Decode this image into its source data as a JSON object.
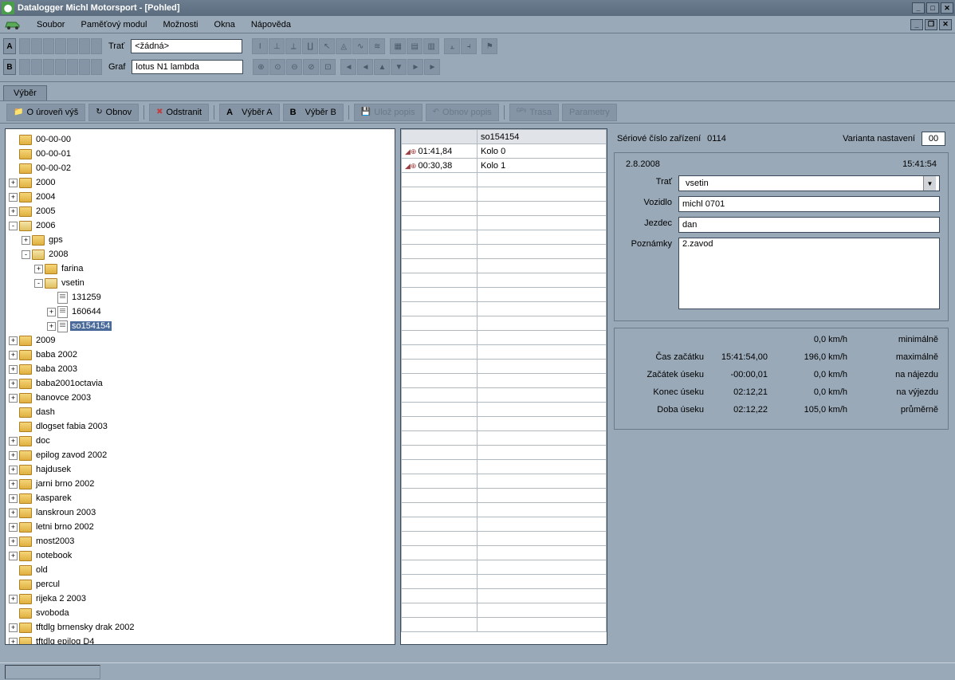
{
  "window": {
    "title": "Datalogger Michl Motorsport - [Pohled]"
  },
  "menu": {
    "items": [
      "Soubor",
      "Paměťový modul",
      "Možnosti",
      "Okna",
      "Nápověda"
    ]
  },
  "toolbar": {
    "trat_label": "Trať",
    "trat_value": "<žádná>",
    "graf_label": "Graf",
    "graf_value": "lotus N1 lambda",
    "a": "A",
    "b": "B"
  },
  "tabs": {
    "vyber": "Výběr"
  },
  "actions": {
    "up": "O úroveň výš",
    "refresh": "Obnov",
    "delete": "Odstranit",
    "sel_a": "Výběr A",
    "sel_b": "Výběr B",
    "save_desc": "Ulož popis",
    "restore_desc": "Obnov popis",
    "trasa": "Trasa",
    "params": "Parametry",
    "a": "A",
    "b": "B"
  },
  "tree": [
    {
      "d": 0,
      "exp": "",
      "ico": "fc",
      "label": "00-00-00"
    },
    {
      "d": 0,
      "exp": "",
      "ico": "fc",
      "label": "00-00-01"
    },
    {
      "d": 0,
      "exp": "",
      "ico": "fc",
      "label": "00-00-02"
    },
    {
      "d": 0,
      "exp": "+",
      "ico": "fc",
      "label": "2000"
    },
    {
      "d": 0,
      "exp": "+",
      "ico": "fc",
      "label": "2004"
    },
    {
      "d": 0,
      "exp": "+",
      "ico": "fc",
      "label": "2005"
    },
    {
      "d": 0,
      "exp": "-",
      "ico": "fo",
      "label": "2006"
    },
    {
      "d": 1,
      "exp": "+",
      "ico": "fc",
      "label": "gps"
    },
    {
      "d": 1,
      "exp": "-",
      "ico": "fo",
      "label": "2008"
    },
    {
      "d": 2,
      "exp": "+",
      "ico": "fc",
      "label": "farina"
    },
    {
      "d": 2,
      "exp": "-",
      "ico": "fo",
      "label": "vsetin"
    },
    {
      "d": 3,
      "exp": "",
      "ico": "file",
      "label": "131259"
    },
    {
      "d": 3,
      "exp": "+",
      "ico": "file",
      "label": "160644"
    },
    {
      "d": 3,
      "exp": "+",
      "ico": "file",
      "label": "so154154",
      "sel": true
    },
    {
      "d": 0,
      "exp": "+",
      "ico": "fc",
      "label": "2009"
    },
    {
      "d": 0,
      "exp": "+",
      "ico": "fc",
      "label": "baba 2002"
    },
    {
      "d": 0,
      "exp": "+",
      "ico": "fc",
      "label": "baba 2003"
    },
    {
      "d": 0,
      "exp": "+",
      "ico": "fc",
      "label": "baba2001octavia"
    },
    {
      "d": 0,
      "exp": "+",
      "ico": "fc",
      "label": "banovce 2003"
    },
    {
      "d": 0,
      "exp": "",
      "ico": "fc",
      "label": "dash"
    },
    {
      "d": 0,
      "exp": "",
      "ico": "fc",
      "label": "dlogset fabia 2003"
    },
    {
      "d": 0,
      "exp": "+",
      "ico": "fc",
      "label": "doc"
    },
    {
      "d": 0,
      "exp": "+",
      "ico": "fc",
      "label": "epilog zavod 2002"
    },
    {
      "d": 0,
      "exp": "+",
      "ico": "fc",
      "label": "hajdusek"
    },
    {
      "d": 0,
      "exp": "+",
      "ico": "fc",
      "label": "jarni brno 2002"
    },
    {
      "d": 0,
      "exp": "+",
      "ico": "fc",
      "label": "kasparek"
    },
    {
      "d": 0,
      "exp": "+",
      "ico": "fc",
      "label": "lanskroun 2003"
    },
    {
      "d": 0,
      "exp": "+",
      "ico": "fc",
      "label": "letni brno 2002"
    },
    {
      "d": 0,
      "exp": "+",
      "ico": "fc",
      "label": "most2003"
    },
    {
      "d": 0,
      "exp": "+",
      "ico": "fc",
      "label": "notebook"
    },
    {
      "d": 0,
      "exp": "",
      "ico": "fc",
      "label": "old"
    },
    {
      "d": 0,
      "exp": "",
      "ico": "fc",
      "label": "percul"
    },
    {
      "d": 0,
      "exp": "+",
      "ico": "fc",
      "label": "rijeka 2 2003"
    },
    {
      "d": 0,
      "exp": "",
      "ico": "fc",
      "label": "svoboda"
    },
    {
      "d": 0,
      "exp": "+",
      "ico": "fc",
      "label": "tftdlg brnensky drak 2002"
    },
    {
      "d": 0,
      "exp": "+",
      "ico": "fc",
      "label": "tftdlg epilog D4"
    }
  ],
  "laps": {
    "header_file": "so154154",
    "rows": [
      {
        "time": "01:41,84",
        "name": "Kolo 0"
      },
      {
        "time": "00:30,38",
        "name": "Kolo 1"
      }
    ],
    "empty_rows": 32
  },
  "detail": {
    "serial_label": "Sériové číslo zařízení",
    "serial_value": "0114",
    "variant_label": "Varianta nastavení",
    "variant_value": "00",
    "date": "2.8.2008",
    "time": "15:41:54",
    "trat_label": "Trať",
    "trat_value": "vsetin",
    "vozidlo_label": "Vozidlo",
    "vozidlo_value": "michl 0701",
    "jezdec_label": "Jezdec",
    "jezdec_value": "dan",
    "poznamky_label": "Poznámky",
    "poznamky_value": "2.zavod"
  },
  "stats": {
    "rows": [
      {
        "l": "",
        "v": "",
        "s": "0,0 km/h",
        "t": "minimálně"
      },
      {
        "l": "Čas začátku",
        "v": "15:41:54,00",
        "s": "196,0 km/h",
        "t": "maximálně"
      },
      {
        "l": "Začátek úseku",
        "v": "-00:00,01",
        "s": "0,0 km/h",
        "t": "na nájezdu"
      },
      {
        "l": "Konec úseku",
        "v": "02:12,21",
        "s": "0,0 km/h",
        "t": "na výjezdu"
      },
      {
        "l": "Doba úseku",
        "v": "02:12,22",
        "s": "105,0 km/h",
        "t": "průměrně"
      }
    ]
  }
}
